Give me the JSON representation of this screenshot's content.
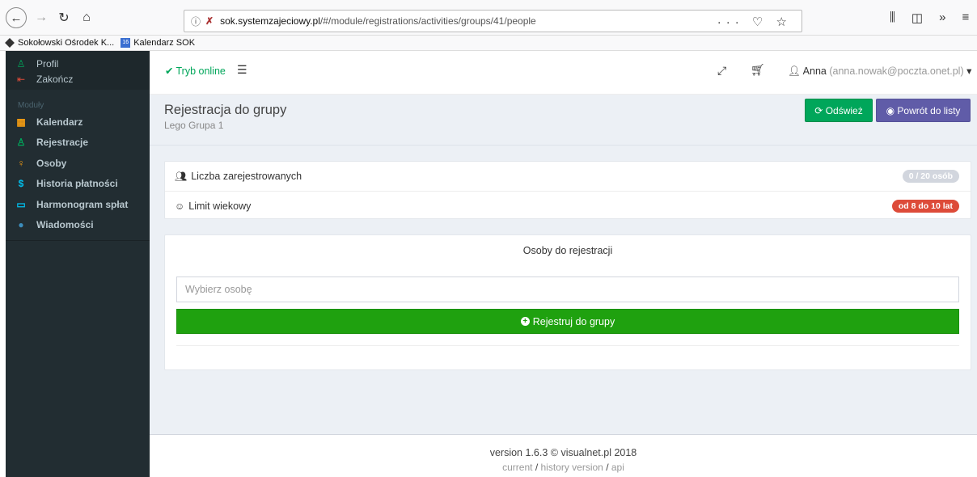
{
  "browser": {
    "url_domain": "sok.systemzajeciowy.pl",
    "url_path": "/#/module/registrations/activities/groups/41/people",
    "bookmarks": [
      {
        "label": "Sokołowski Ośrodek K...",
        "icon": "diamond-icon"
      },
      {
        "label": "Kalendarz SOK",
        "icon": "calendar-icon",
        "icon_text": "16"
      }
    ]
  },
  "sidebar": {
    "profile": "Profil",
    "logout": "Zakończ",
    "modules_label": "Moduły",
    "items": [
      {
        "label": "Kalendarz",
        "icon": "calendar-icon",
        "color": "#f39c12"
      },
      {
        "label": "Rejestracje",
        "icon": "user-icon",
        "color": "#00a65a"
      },
      {
        "label": "Osoby",
        "icon": "person-icon",
        "color": "#f39c12"
      },
      {
        "label": "Historia płatności",
        "icon": "dollar-icon",
        "color": "#00c0ef"
      },
      {
        "label": "Harmonogram spłat",
        "icon": "calendar-icon",
        "color": "#00c0ef"
      },
      {
        "label": "Wiadomości",
        "icon": "comments-icon",
        "color": "#3c8dbc"
      }
    ]
  },
  "navbar": {
    "online": "Tryb online",
    "user_name": "Anna",
    "user_email": "(anna.nowak@poczta.onet.pl)"
  },
  "header": {
    "title": "Rejestracja do grupy",
    "subtitle": "Lego Grupa 1",
    "refresh_label": "Odśwież",
    "back_label": "Powrót do listy"
  },
  "info": {
    "registered_label": "Liczba zarejestrowanych",
    "registered_badge": "0 / 20 osób",
    "age_label": "Limit wiekowy",
    "age_badge": "od 8 do 10 lat"
  },
  "registration": {
    "title": "Osoby do rejestracji",
    "person_placeholder": "Wybierz osobę",
    "register_label": "Rejestruj do grupy"
  },
  "footer": {
    "version": "version 1.6.3 © visualnet.pl 2018",
    "link_current": "current",
    "link_history": "history version",
    "link_api": "api"
  },
  "colors": {
    "sidebar_bg": "#222d32",
    "success": "#00a65a",
    "purple": "#605ca8",
    "danger": "#dd4b39"
  }
}
